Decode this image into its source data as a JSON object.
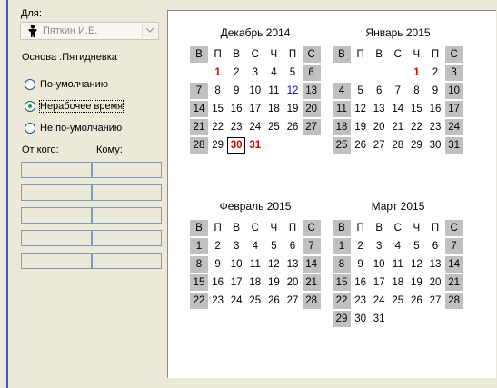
{
  "left": {
    "for_label": "Для:",
    "person_select": {
      "value": "Пяткин И.Е.",
      "icon": "person-icon"
    },
    "basis_label": "Основа :Пятидневка",
    "radios": [
      {
        "label": "По-умолчанию",
        "checked": false
      },
      {
        "label": "Нерабочее время",
        "checked": true
      },
      {
        "label": "Не по-умолчанию",
        "checked": false
      }
    ],
    "from_label": "От кого:",
    "to_label": "Кому:",
    "grid_rows": 5
  },
  "colors": {
    "accent_border": "#3a5bbf",
    "red_day": "#e00000",
    "blue_day": "#0000cc",
    "gray_cell": "#c0c0c0"
  },
  "weekday_headers": [
    "В",
    "П",
    "В",
    "С",
    "Ч",
    "П",
    "С"
  ],
  "calendars": [
    {
      "title": "Декабрь 2014",
      "weeks": [
        [
          "",
          "1",
          "2",
          "3",
          "4",
          "5",
          "6"
        ],
        [
          "7",
          "8",
          "9",
          "10",
          "11",
          "12",
          "13"
        ],
        [
          "14",
          "15",
          "16",
          "17",
          "18",
          "19",
          "20"
        ],
        [
          "21",
          "22",
          "23",
          "24",
          "25",
          "26",
          "27"
        ],
        [
          "28",
          "29",
          "30",
          "31",
          "",
          "",
          ""
        ]
      ],
      "red_days": [
        "1",
        "30",
        "31"
      ],
      "blue_days": [
        "12"
      ],
      "selected_day": "30"
    },
    {
      "title": "Январь 2015",
      "weeks": [
        [
          "",
          "",
          "",
          "",
          "1",
          "2",
          "3"
        ],
        [
          "4",
          "5",
          "6",
          "7",
          "8",
          "9",
          "10"
        ],
        [
          "11",
          "12",
          "13",
          "14",
          "15",
          "16",
          "17"
        ],
        [
          "18",
          "19",
          "20",
          "21",
          "22",
          "23",
          "24"
        ],
        [
          "25",
          "26",
          "27",
          "28",
          "29",
          "30",
          "31"
        ]
      ],
      "red_days": [
        "1"
      ],
      "blue_days": [],
      "selected_day": ""
    },
    {
      "title": "Февраль 2015",
      "weeks": [
        [
          "1",
          "2",
          "3",
          "4",
          "5",
          "6",
          "7"
        ],
        [
          "8",
          "9",
          "10",
          "11",
          "12",
          "13",
          "14"
        ],
        [
          "15",
          "16",
          "17",
          "18",
          "19",
          "20",
          "21"
        ],
        [
          "22",
          "23",
          "24",
          "25",
          "26",
          "27",
          "28"
        ]
      ],
      "red_days": [],
      "blue_days": [],
      "selected_day": ""
    },
    {
      "title": "Март 2015",
      "weeks": [
        [
          "1",
          "2",
          "3",
          "4",
          "5",
          "6",
          "7"
        ],
        [
          "8",
          "9",
          "10",
          "11",
          "12",
          "13",
          "14"
        ],
        [
          "15",
          "16",
          "17",
          "18",
          "19",
          "20",
          "21"
        ],
        [
          "22",
          "23",
          "24",
          "25",
          "26",
          "27",
          "28"
        ],
        [
          "29",
          "30",
          "31",
          "",
          "",
          "",
          ""
        ]
      ],
      "red_days": [],
      "blue_days": [],
      "selected_day": ""
    }
  ]
}
